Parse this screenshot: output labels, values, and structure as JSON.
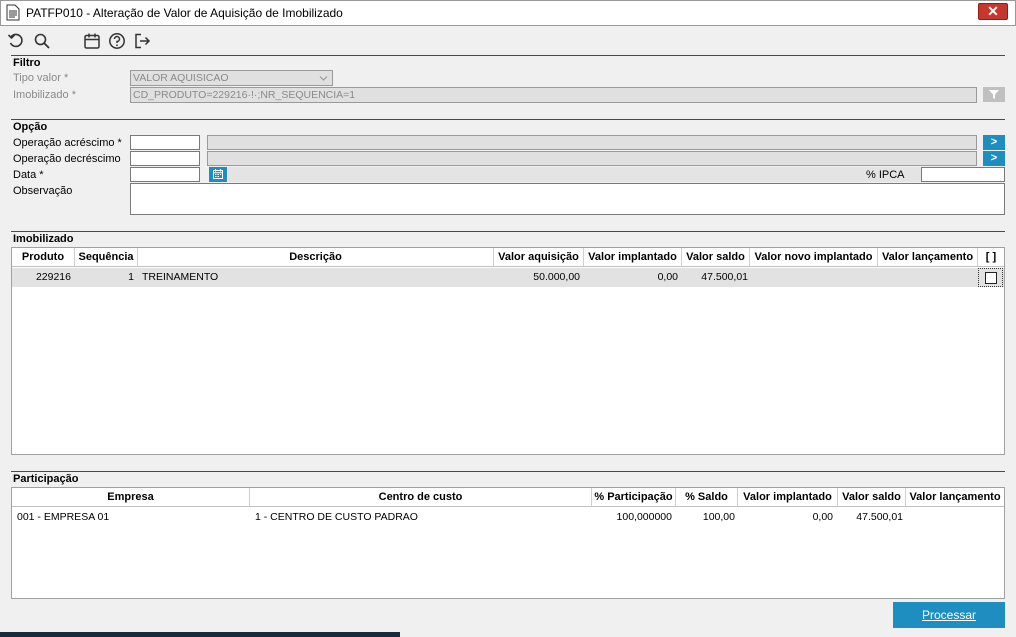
{
  "window": {
    "title": "PATFP010 - Alteração de Valor de Aquisição de Imobilizado",
    "close_label": "✕"
  },
  "toolbar": {
    "icons": [
      "undo-icon",
      "search-icon",
      "calendar-icon",
      "help-icon",
      "exit-icon"
    ]
  },
  "filtro": {
    "title": "Filtro",
    "tipo_valor_label": "Tipo valor *",
    "tipo_valor_value": "VALOR AQUISICAO",
    "imobilizado_label": "Imobilizado *",
    "imobilizado_value": "CD_PRODUTO=229216·!·;NR_SEQUENCIA=1"
  },
  "opcao": {
    "title": "Opção",
    "acrescimo_label": "Operação acréscimo *",
    "decrescimo_label": "Operação decréscimo",
    "data_label": "Data *",
    "ipca_label": "% IPCA",
    "observacao_label": "Observação",
    "arrow": ">"
  },
  "imobilizado": {
    "title": "Imobilizado",
    "headers": [
      "Produto",
      "Sequência",
      "Descrição",
      "Valor aquisição",
      "Valor implantado",
      "Valor saldo",
      "Valor novo implantado",
      "Valor lançamento",
      "[ ]"
    ],
    "rows": [
      {
        "produto": "229216",
        "sequencia": "1",
        "descricao": "TREINAMENTO",
        "valor_aquisicao": "50.000,00",
        "valor_implantado": "0,00",
        "valor_saldo": "47.500,01",
        "valor_novo_implantado": "",
        "valor_lancamento": ""
      }
    ]
  },
  "participacao": {
    "title": "Participação",
    "headers": [
      "Empresa",
      "Centro de custo",
      "% Participação",
      "% Saldo",
      "Valor implantado",
      "Valor saldo",
      "Valor lançamento"
    ],
    "rows": [
      {
        "empresa": "001 - EMPRESA 01",
        "centro_custo": "1 - CENTRO DE CUSTO PADRAO",
        "participacao": "100,000000",
        "saldo": "100,00",
        "valor_implantado": "0,00",
        "valor_saldo": "47.500,01",
        "valor_lancamento": ""
      }
    ]
  },
  "footer": {
    "processar_label": "Processar"
  },
  "colors": {
    "accent": "#1e8ec0",
    "close": "#c7372e"
  }
}
